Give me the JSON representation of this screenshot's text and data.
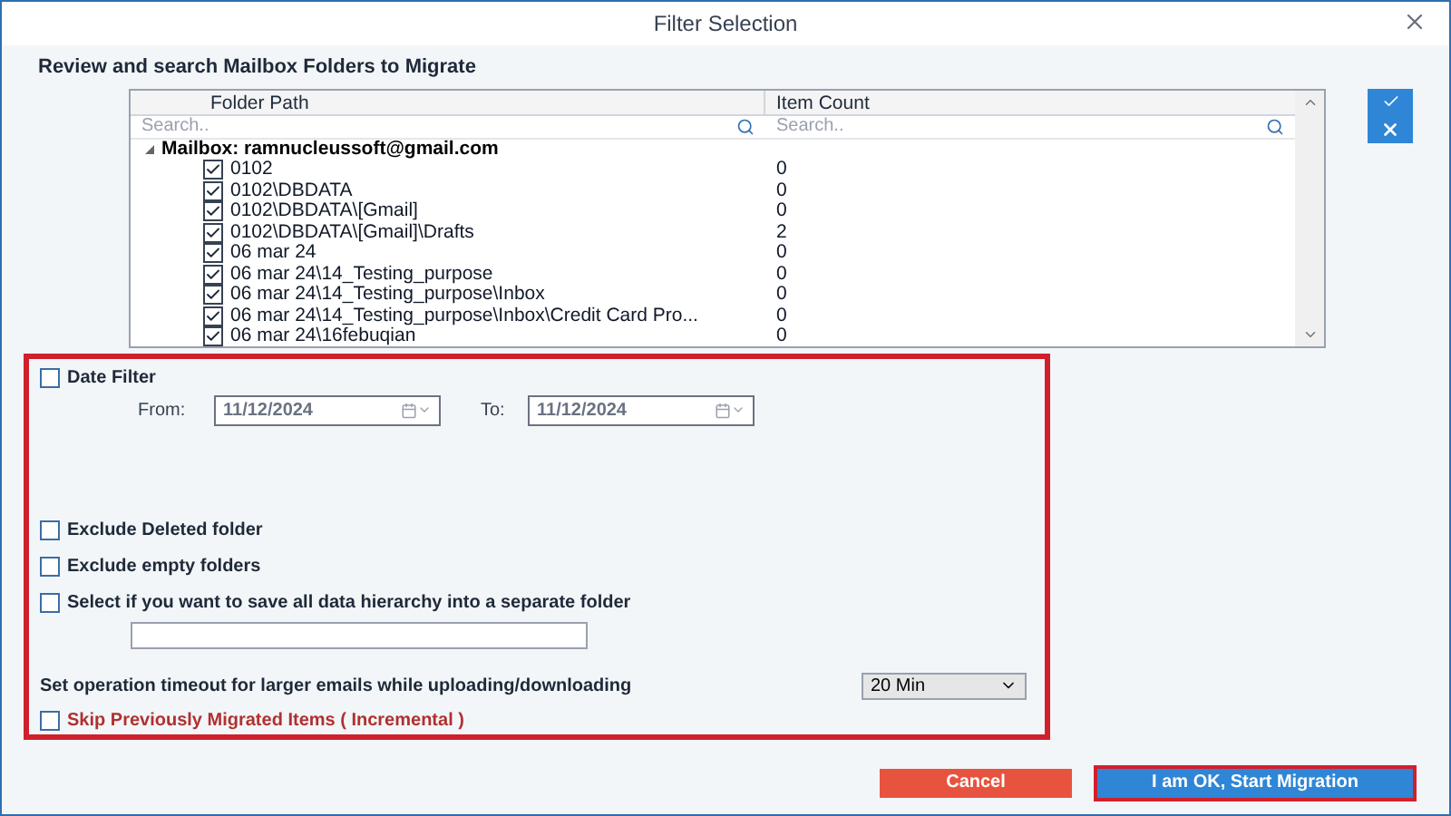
{
  "window": {
    "title": "Filter Selection"
  },
  "heading": "Review and search Mailbox Folders to Migrate",
  "table": {
    "columns": [
      "Folder Path",
      "Item Count"
    ],
    "search_placeholders": [
      "Search..",
      "Search.."
    ],
    "root": {
      "label": "Mailbox: ramnucleussoft@gmail.com",
      "expanded": true,
      "children": [
        {
          "label": "0102",
          "count": "0",
          "checked": true
        },
        {
          "label": "0102\\DBDATA",
          "count": "0",
          "checked": true
        },
        {
          "label": "0102\\DBDATA\\[Gmail]",
          "count": "0",
          "checked": true
        },
        {
          "label": "0102\\DBDATA\\[Gmail]\\Drafts",
          "count": "2",
          "checked": true
        },
        {
          "label": "06 mar 24",
          "count": "0",
          "checked": true
        },
        {
          "label": "06 mar 24\\14_Testing_purpose",
          "count": "0",
          "checked": true
        },
        {
          "label": "06 mar 24\\14_Testing_purpose\\Inbox",
          "count": "0",
          "checked": true
        },
        {
          "label": "06 mar 24\\14_Testing_purpose\\Inbox\\Credit Card Pro...",
          "count": "0",
          "checked": true
        },
        {
          "label": "06 mar 24\\16febuqian",
          "count": "0",
          "checked": true
        }
      ]
    }
  },
  "date_filter": {
    "label": "Date Filter",
    "checked": false,
    "from_label": "From:",
    "from": "11/12/2024",
    "to_label": "To:",
    "to": "11/12/2024"
  },
  "options": [
    {
      "label": "Exclude Deleted folder",
      "checked": false
    },
    {
      "label": "Exclude empty folders",
      "checked": false
    },
    {
      "label": "Select if you want to save all data hierarchy into a separate folder",
      "checked": false
    }
  ],
  "timeout": {
    "label": "Set operation timeout for larger emails while uploading/downloading",
    "value": "20 Min"
  },
  "incremental": {
    "label": "Skip Previously Migrated Items ( Incremental )",
    "checked": false
  },
  "buttons": {
    "cancel": "Cancel",
    "start": "I am OK, Start Migration"
  }
}
